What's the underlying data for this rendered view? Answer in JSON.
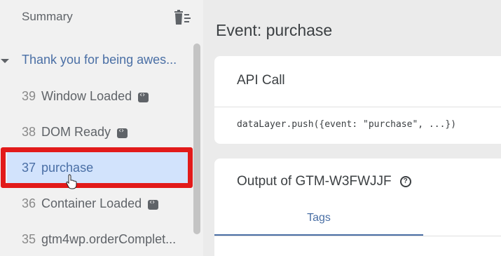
{
  "sidebar": {
    "title": "Summary",
    "group_label": "Thank you for being awes...",
    "items": [
      {
        "num": "39",
        "label": "Window Loaded",
        "badge": true
      },
      {
        "num": "38",
        "label": "DOM Ready",
        "badge": true
      },
      {
        "num": "37",
        "label": "purchase",
        "badge": false,
        "selected": true
      },
      {
        "num": "36",
        "label": "Container Loaded",
        "badge": true
      },
      {
        "num": "35",
        "label": "gtm4wp.orderComplet...",
        "badge": false
      }
    ]
  },
  "main": {
    "event_title": "Event: purchase",
    "api_card": {
      "heading": "API Call",
      "code": "dataLayer.push({event: \"purchase\", ...})"
    },
    "output_card": {
      "heading": "Output of GTM-W3FWJJF",
      "help_symbol": "?",
      "tab_label": "Tags"
    }
  },
  "colors": {
    "selected_bg": "#d2e3fc",
    "accent": "#4a6fa5",
    "highlight": "#e21a1a"
  }
}
